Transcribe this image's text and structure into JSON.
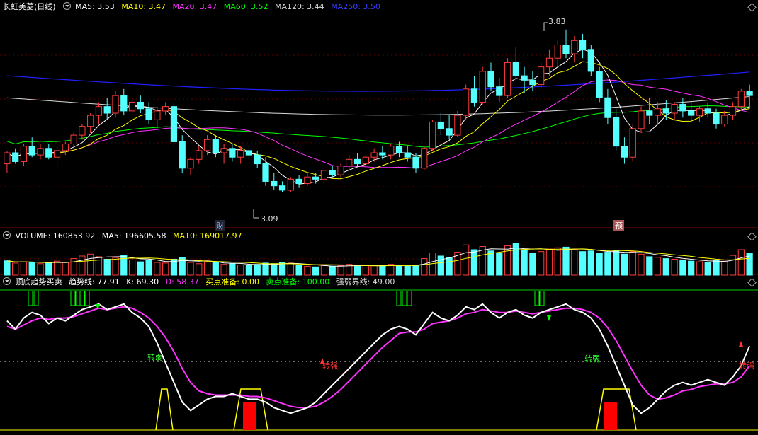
{
  "price_legend": {
    "title": "长虹美菱(日线)",
    "ma5": "MA5: 3.53",
    "ma10": "MA10: 3.47",
    "ma20": "MA20: 3.47",
    "ma60": "MA60: 3.52",
    "ma120": "MA120: 3.44",
    "ma250": "MA250: 3.50"
  },
  "volume_legend": {
    "volume": "VOLUME: 160853.92",
    "ma5": "MA5: 196605.58",
    "ma10": "MA10: 169017.97"
  },
  "indicator_legend": {
    "title": "顶底趋势买卖",
    "trend": "趋势线: 77.91",
    "k": "K: 69.30",
    "d": "D: 58.37",
    "buy_ready": "买点准备: 0.00",
    "sell_ready": "卖点准备: 100.00",
    "threshold": "强弱界线: 49.00"
  },
  "annotations": {
    "high": "3.83",
    "low": "3.09",
    "tag_cai": "财",
    "tag_yu": "预",
    "weak1": "转弱",
    "strong1": "转强",
    "weak2": "转弱",
    "strong2": "转强"
  },
  "colors": {
    "up": "#ff3c3c",
    "down": "#54ffff",
    "ma5": "#ffffff",
    "ma10": "#ffff00",
    "ma20": "#ff33ff",
    "ma60": "#00ff00",
    "ma120": "#d9d9d9",
    "ma250": "#2020ff",
    "grid": "#8b0000"
  },
  "chart_data": {
    "type": "candlestick",
    "ylim": [
      3.0,
      3.9
    ],
    "ohlc": [
      [
        3.22,
        3.28,
        3.18,
        3.27
      ],
      [
        3.27,
        3.29,
        3.22,
        3.23
      ],
      [
        3.23,
        3.31,
        3.21,
        3.3
      ],
      [
        3.3,
        3.34,
        3.25,
        3.26
      ],
      [
        3.26,
        3.31,
        3.24,
        3.29
      ],
      [
        3.29,
        3.31,
        3.24,
        3.25
      ],
      [
        3.25,
        3.3,
        3.2,
        3.28
      ],
      [
        3.28,
        3.32,
        3.26,
        3.31
      ],
      [
        3.31,
        3.36,
        3.29,
        3.35
      ],
      [
        3.35,
        3.4,
        3.33,
        3.39
      ],
      [
        3.39,
        3.45,
        3.36,
        3.44
      ],
      [
        3.44,
        3.5,
        3.4,
        3.48
      ],
      [
        3.48,
        3.52,
        3.42,
        3.45
      ],
      [
        3.45,
        3.55,
        3.43,
        3.53
      ],
      [
        3.53,
        3.56,
        3.44,
        3.46
      ],
      [
        3.46,
        3.52,
        3.4,
        3.5
      ],
      [
        3.5,
        3.53,
        3.45,
        3.47
      ],
      [
        3.47,
        3.5,
        3.4,
        3.42
      ],
      [
        3.42,
        3.48,
        3.38,
        3.46
      ],
      [
        3.46,
        3.5,
        3.44,
        3.48
      ],
      [
        3.48,
        3.5,
        3.3,
        3.32
      ],
      [
        3.32,
        3.35,
        3.18,
        3.2
      ],
      [
        3.2,
        3.25,
        3.17,
        3.24
      ],
      [
        3.24,
        3.3,
        3.22,
        3.28
      ],
      [
        3.28,
        3.35,
        3.26,
        3.33
      ],
      [
        3.33,
        3.35,
        3.25,
        3.27
      ],
      [
        3.27,
        3.31,
        3.22,
        3.29
      ],
      [
        3.29,
        3.31,
        3.23,
        3.25
      ],
      [
        3.25,
        3.3,
        3.22,
        3.28
      ],
      [
        3.28,
        3.3,
        3.24,
        3.26
      ],
      [
        3.26,
        3.28,
        3.2,
        3.22
      ],
      [
        3.22,
        3.25,
        3.12,
        3.14
      ],
      [
        3.14,
        3.18,
        3.1,
        3.12
      ],
      [
        3.12,
        3.14,
        3.09,
        3.1
      ],
      [
        3.1,
        3.16,
        3.09,
        3.15
      ],
      [
        3.15,
        3.17,
        3.11,
        3.13
      ],
      [
        3.13,
        3.18,
        3.12,
        3.16
      ],
      [
        3.16,
        3.18,
        3.13,
        3.15
      ],
      [
        3.15,
        3.2,
        3.14,
        3.19
      ],
      [
        3.19,
        3.21,
        3.16,
        3.17
      ],
      [
        3.17,
        3.22,
        3.16,
        3.21
      ],
      [
        3.21,
        3.26,
        3.19,
        3.24
      ],
      [
        3.24,
        3.27,
        3.21,
        3.22
      ],
      [
        3.22,
        3.26,
        3.2,
        3.25
      ],
      [
        3.25,
        3.29,
        3.23,
        3.27
      ],
      [
        3.27,
        3.3,
        3.24,
        3.26
      ],
      [
        3.26,
        3.31,
        3.24,
        3.3
      ],
      [
        3.3,
        3.32,
        3.25,
        3.27
      ],
      [
        3.27,
        3.3,
        3.23,
        3.25
      ],
      [
        3.25,
        3.27,
        3.18,
        3.2
      ],
      [
        3.2,
        3.3,
        3.19,
        3.29
      ],
      [
        3.29,
        3.42,
        3.28,
        3.41
      ],
      [
        3.41,
        3.45,
        3.35,
        3.38
      ],
      [
        3.38,
        3.44,
        3.33,
        3.35
      ],
      [
        3.35,
        3.46,
        3.34,
        3.44
      ],
      [
        3.44,
        3.58,
        3.42,
        3.56
      ],
      [
        3.56,
        3.62,
        3.48,
        3.5
      ],
      [
        3.5,
        3.66,
        3.49,
        3.64
      ],
      [
        3.64,
        3.68,
        3.55,
        3.57
      ],
      [
        3.57,
        3.61,
        3.5,
        3.53
      ],
      [
        3.53,
        3.7,
        3.52,
        3.68
      ],
      [
        3.68,
        3.75,
        3.6,
        3.62
      ],
      [
        3.62,
        3.66,
        3.54,
        3.6
      ],
      [
        3.6,
        3.64,
        3.55,
        3.58
      ],
      [
        3.58,
        3.68,
        3.56,
        3.66
      ],
      [
        3.66,
        3.74,
        3.62,
        3.7
      ],
      [
        3.7,
        3.78,
        3.66,
        3.76
      ],
      [
        3.76,
        3.83,
        3.7,
        3.72
      ],
      [
        3.72,
        3.8,
        3.68,
        3.78
      ],
      [
        3.78,
        3.81,
        3.7,
        3.74
      ],
      [
        3.74,
        3.76,
        3.62,
        3.64
      ],
      [
        3.64,
        3.66,
        3.5,
        3.52
      ],
      [
        3.52,
        3.56,
        3.4,
        3.43
      ],
      [
        3.43,
        3.47,
        3.28,
        3.3
      ],
      [
        3.3,
        3.34,
        3.22,
        3.25
      ],
      [
        3.25,
        3.4,
        3.23,
        3.38
      ],
      [
        3.38,
        3.48,
        3.36,
        3.46
      ],
      [
        3.46,
        3.52,
        3.4,
        3.44
      ],
      [
        3.44,
        3.5,
        3.4,
        3.47
      ],
      [
        3.47,
        3.51,
        3.42,
        3.45
      ],
      [
        3.45,
        3.5,
        3.42,
        3.49
      ],
      [
        3.49,
        3.52,
        3.43,
        3.46
      ],
      [
        3.46,
        3.5,
        3.42,
        3.44
      ],
      [
        3.44,
        3.48,
        3.41,
        3.47
      ],
      [
        3.47,
        3.5,
        3.43,
        3.45
      ],
      [
        3.45,
        3.47,
        3.38,
        3.4
      ],
      [
        3.4,
        3.46,
        3.39,
        3.44
      ],
      [
        3.44,
        3.5,
        3.42,
        3.48
      ],
      [
        3.48,
        3.56,
        3.46,
        3.55
      ],
      [
        3.55,
        3.58,
        3.47,
        3.53
      ]
    ],
    "volume": [
      {
        "v": 0.45,
        "up": false
      },
      {
        "v": 0.38,
        "up": true
      },
      {
        "v": 0.42,
        "up": true
      },
      {
        "v": 0.4,
        "up": false
      },
      {
        "v": 0.36,
        "up": true
      },
      {
        "v": 0.38,
        "up": false
      },
      {
        "v": 0.44,
        "up": true
      },
      {
        "v": 0.4,
        "up": true
      },
      {
        "v": 0.52,
        "up": true
      },
      {
        "v": 0.6,
        "up": true
      },
      {
        "v": 0.66,
        "up": true
      },
      {
        "v": 0.58,
        "up": true
      },
      {
        "v": 0.5,
        "up": false
      },
      {
        "v": 0.55,
        "up": true
      },
      {
        "v": 0.62,
        "up": false
      },
      {
        "v": 0.48,
        "up": true
      },
      {
        "v": 0.42,
        "up": false
      },
      {
        "v": 0.46,
        "up": false
      },
      {
        "v": 0.4,
        "up": true
      },
      {
        "v": 0.38,
        "up": true
      },
      {
        "v": 0.5,
        "up": false
      },
      {
        "v": 0.56,
        "up": false
      },
      {
        "v": 0.4,
        "up": true
      },
      {
        "v": 0.36,
        "up": true
      },
      {
        "v": 0.42,
        "up": true
      },
      {
        "v": 0.4,
        "up": false
      },
      {
        "v": 0.34,
        "up": true
      },
      {
        "v": 0.36,
        "up": false
      },
      {
        "v": 0.32,
        "up": true
      },
      {
        "v": 0.3,
        "up": false
      },
      {
        "v": 0.34,
        "up": false
      },
      {
        "v": 0.38,
        "up": false
      },
      {
        "v": 0.36,
        "up": false
      },
      {
        "v": 0.4,
        "up": false
      },
      {
        "v": 0.38,
        "up": true
      },
      {
        "v": 0.3,
        "up": false
      },
      {
        "v": 0.28,
        "up": true
      },
      {
        "v": 0.26,
        "up": false
      },
      {
        "v": 0.3,
        "up": true
      },
      {
        "v": 0.28,
        "up": false
      },
      {
        "v": 0.3,
        "up": true
      },
      {
        "v": 0.34,
        "up": true
      },
      {
        "v": 0.28,
        "up": false
      },
      {
        "v": 0.3,
        "up": true
      },
      {
        "v": 0.32,
        "up": true
      },
      {
        "v": 0.28,
        "up": false
      },
      {
        "v": 0.34,
        "up": true
      },
      {
        "v": 0.3,
        "up": false
      },
      {
        "v": 0.28,
        "up": false
      },
      {
        "v": 0.32,
        "up": false
      },
      {
        "v": 0.52,
        "up": true
      },
      {
        "v": 0.7,
        "up": true
      },
      {
        "v": 0.6,
        "up": false
      },
      {
        "v": 0.56,
        "up": false
      },
      {
        "v": 0.72,
        "up": true
      },
      {
        "v": 0.95,
        "up": true
      },
      {
        "v": 0.8,
        "up": false
      },
      {
        "v": 0.9,
        "up": true
      },
      {
        "v": 0.76,
        "up": false
      },
      {
        "v": 0.7,
        "up": false
      },
      {
        "v": 0.92,
        "up": true
      },
      {
        "v": 1.0,
        "up": false
      },
      {
        "v": 0.78,
        "up": false
      },
      {
        "v": 0.7,
        "up": false
      },
      {
        "v": 0.74,
        "up": true
      },
      {
        "v": 0.82,
        "up": true
      },
      {
        "v": 0.86,
        "up": true
      },
      {
        "v": 0.88,
        "up": false
      },
      {
        "v": 0.8,
        "up": true
      },
      {
        "v": 0.74,
        "up": false
      },
      {
        "v": 0.76,
        "up": false
      },
      {
        "v": 0.7,
        "up": false
      },
      {
        "v": 0.72,
        "up": false
      },
      {
        "v": 0.76,
        "up": false
      },
      {
        "v": 0.66,
        "up": false
      },
      {
        "v": 0.74,
        "up": true
      },
      {
        "v": 0.66,
        "up": true
      },
      {
        "v": 0.58,
        "up": false
      },
      {
        "v": 0.56,
        "up": true
      },
      {
        "v": 0.52,
        "up": false
      },
      {
        "v": 0.5,
        "up": true
      },
      {
        "v": 0.48,
        "up": false
      },
      {
        "v": 0.44,
        "up": false
      },
      {
        "v": 0.42,
        "up": true
      },
      {
        "v": 0.4,
        "up": false
      },
      {
        "v": 0.46,
        "up": false
      },
      {
        "v": 0.44,
        "up": true
      },
      {
        "v": 0.62,
        "up": true
      },
      {
        "v": 0.8,
        "up": true
      },
      {
        "v": 0.7,
        "up": false
      }
    ],
    "k_line": [
      78,
      72,
      80,
      84,
      82,
      76,
      80,
      78,
      82,
      86,
      88,
      90,
      86,
      88,
      90,
      84,
      80,
      74,
      62,
      48,
      34,
      20,
      14,
      18,
      22,
      24,
      24,
      26,
      24,
      22,
      22,
      20,
      16,
      14,
      12,
      14,
      16,
      20,
      26,
      32,
      38,
      44,
      50,
      56,
      62,
      68,
      72,
      74,
      72,
      68,
      76,
      84,
      80,
      78,
      82,
      88,
      86,
      90,
      84,
      80,
      84,
      86,
      82,
      80,
      84,
      86,
      88,
      90,
      86,
      84,
      80,
      72,
      60,
      46,
      32,
      18,
      12,
      16,
      22,
      28,
      32,
      34,
      32,
      34,
      36,
      34,
      32,
      38,
      46,
      60
    ],
    "d_line": [
      74,
      72,
      75,
      78,
      80,
      79,
      80,
      80,
      81,
      83,
      85,
      87,
      86,
      87,
      88,
      87,
      84,
      80,
      74,
      66,
      56,
      44,
      34,
      28,
      26,
      25,
      25,
      25,
      25,
      24,
      24,
      23,
      21,
      19,
      17,
      16,
      16,
      17,
      20,
      24,
      29,
      35,
      41,
      47,
      53,
      59,
      64,
      69,
      70,
      70,
      72,
      76,
      77,
      78,
      80,
      83,
      84,
      86,
      85,
      84,
      84,
      85,
      84,
      83,
      84,
      85,
      86,
      87,
      87,
      86,
      84,
      80,
      73,
      64,
      53,
      42,
      32,
      25,
      22,
      23,
      25,
      28,
      29,
      31,
      32,
      33,
      33,
      34,
      38,
      46
    ],
    "threshold": 49.0
  }
}
